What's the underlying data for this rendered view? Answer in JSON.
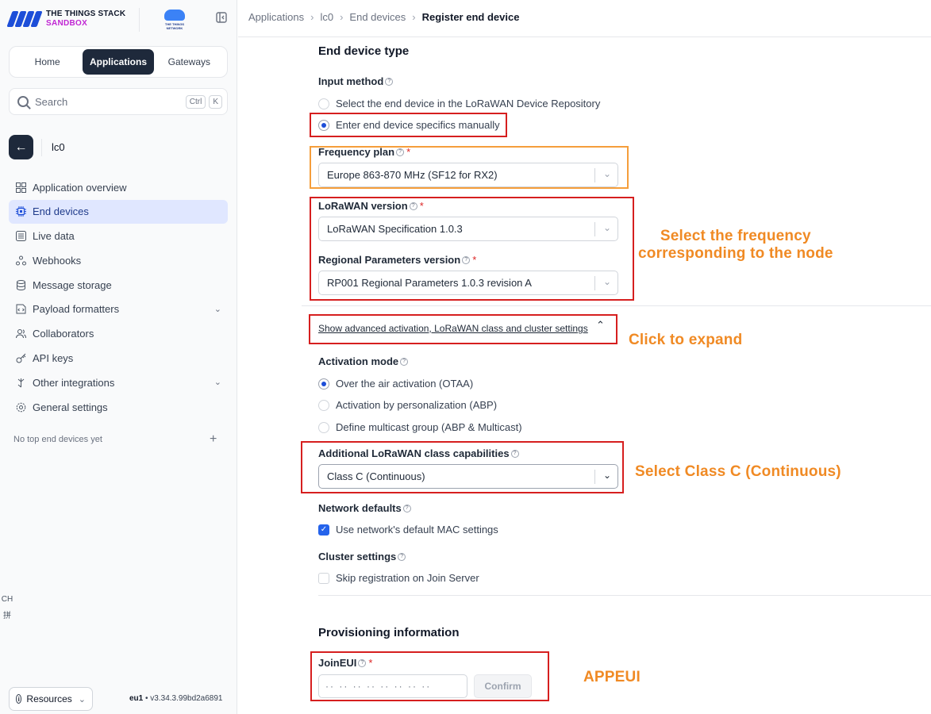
{
  "brand": {
    "line1": "THE THINGS STACK",
    "line2": "SANDBOX",
    "ttn_line1": "THE THINGS",
    "ttn_line2": "NETWORK"
  },
  "nav_tabs": [
    "Home",
    "Applications",
    "Gateways"
  ],
  "search": {
    "placeholder": "Search",
    "kbd1": "Ctrl",
    "kbd2": "K"
  },
  "application": {
    "name": "lc0"
  },
  "sidebar_menu": [
    {
      "label": "Application overview",
      "icon": "grid-icon"
    },
    {
      "label": "End devices",
      "icon": "chip-icon"
    },
    {
      "label": "Live data",
      "icon": "list-icon"
    },
    {
      "label": "Webhooks",
      "icon": "webhook-icon"
    },
    {
      "label": "Message storage",
      "icon": "database-icon"
    },
    {
      "label": "Payload formatters",
      "icon": "code-icon"
    },
    {
      "label": "Collaborators",
      "icon": "users-icon"
    },
    {
      "label": "API keys",
      "icon": "key-icon"
    },
    {
      "label": "Other integrations",
      "icon": "integrations-icon"
    },
    {
      "label": "General settings",
      "icon": "gear-icon"
    }
  ],
  "top_devices": {
    "empty": "No top end devices yet"
  },
  "ime": {
    "a": "CH",
    "b": "拼"
  },
  "footer": {
    "resources": "Resources",
    "region": "eu1",
    "version": "v3.34.3.99bd2a6891"
  },
  "breadcrumb": [
    "Applications",
    "lc0",
    "End devices",
    "Register end device"
  ],
  "form": {
    "section_title": "End device type",
    "input_method_label": "Input method",
    "input_method_options": [
      "Select the end device in the LoRaWAN Device Repository",
      "Enter end device specifics manually"
    ],
    "frequency_plan_label": "Frequency plan",
    "frequency_plan_value": "Europe 863-870 MHz (SF12 for RX2)",
    "lorawan_version_label": "LoRaWAN version",
    "lorawan_version_value": "LoRaWAN Specification 1.0.3",
    "regional_params_label": "Regional Parameters version",
    "regional_params_value": "RP001 Regional Parameters 1.0.3 revision A",
    "advanced_link": "Show advanced activation, LoRaWAN class and cluster settings",
    "activation_mode_label": "Activation mode",
    "activation_options": [
      "Over the air activation (OTAA)",
      "Activation by personalization (ABP)",
      "Define multicast group (ABP & Multicast)"
    ],
    "class_label": "Additional LoRaWAN class capabilities",
    "class_value": "Class C (Continuous)",
    "network_defaults_label": "Network defaults",
    "network_defaults_option": "Use network's default MAC settings",
    "cluster_label": "Cluster settings",
    "cluster_option": "Skip registration on Join Server",
    "provisioning_title": "Provisioning information",
    "joineui_label": "JoinEUI",
    "joineui_placeholder": "·· ·· ·· ·· ·· ·· ·· ··",
    "confirm_label": "Confirm"
  },
  "annotations": {
    "frequency": "Select the frequency\ncorresponding to the node",
    "expand": "Click to expand",
    "class_c": "Select Class C (Continuous)",
    "appeui": "APPEUI"
  },
  "colors": {
    "annotation_text": "#f08a24",
    "highlight_red": "#d61f1f",
    "highlight_orange": "#f59e3b",
    "primary": "#1d4ed8",
    "nav_active": "#1e293b"
  }
}
